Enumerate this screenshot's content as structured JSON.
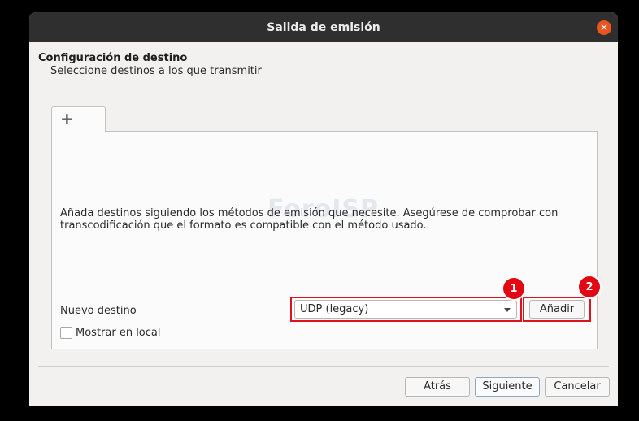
{
  "window": {
    "title": "Salida de emisión"
  },
  "header": {
    "title": "Configuración de destino",
    "subtitle": "Seleccione destinos a los que transmitir"
  },
  "tab": {
    "icon": "plus-icon",
    "label": "+"
  },
  "panel": {
    "instructions": "Añada destinos siguiendo los métodos de emisión que necesite. Asegúrese de comprobar con transcodificación que el formato es compatible con el método usado.",
    "watermark": "ForoISP"
  },
  "destination": {
    "label": "Nuevo destino",
    "selected": "UDP (legacy)",
    "add_label": "Añadir",
    "show_local_label": "Mostrar en local",
    "show_local_checked": false
  },
  "annotations": [
    {
      "number": "1"
    },
    {
      "number": "2"
    }
  ],
  "footer": {
    "back_label": "Atrás",
    "next_label": "Siguiente",
    "cancel_label": "Cancelar"
  },
  "colors": {
    "accent_close": "#e95420",
    "annotation_red": "#e30613",
    "titlebar": "#2f2f2f"
  }
}
